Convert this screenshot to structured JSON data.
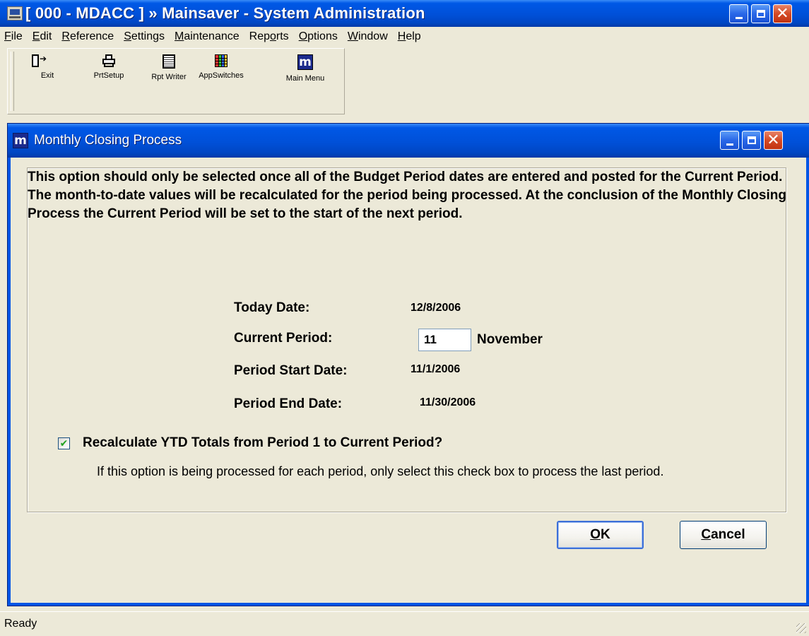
{
  "window": {
    "title": "[ 000 - MDACC ] » Mainsaver - System Administration"
  },
  "menu": {
    "items": [
      {
        "accel": "F",
        "rest": "ile"
      },
      {
        "accel": "E",
        "rest": "dit"
      },
      {
        "accel": "R",
        "rest": "eference"
      },
      {
        "accel": "S",
        "rest": "ettings"
      },
      {
        "accel": "M",
        "rest": "aintenance"
      },
      {
        "pre": "Rep",
        "accel": "o",
        "rest": "rts"
      },
      {
        "accel": "O",
        "rest": "ptions"
      },
      {
        "accel": "W",
        "rest": "indow"
      },
      {
        "accel": "H",
        "rest": "elp"
      }
    ]
  },
  "toolbar": {
    "exit": "Exit",
    "prtsetup": "PrtSetup",
    "rptwriter": "Rpt Writer",
    "appswitches": "AppSwitches",
    "mainmenu": "Main Menu",
    "mainmenu_icon_letter": "m"
  },
  "dialog": {
    "icon_letter": "m",
    "title": "Monthly Closing Process",
    "intro": "This option should only be selected once all of the Budget Period dates are entered and posted for the Current Period.  The month-to-date values will be recalculated for the period being processed.  At the conclusion of the Monthly Closing Process the Current Period will be set to the start of the next period.",
    "today_label": "Today Date:",
    "today_value": "12/8/2006",
    "current_period_label": "Current Period:",
    "current_period_value": "11",
    "current_period_name": "November",
    "start_label": "Period Start Date:",
    "start_value": "11/1/2006",
    "end_label": "Period End Date:",
    "end_value": "11/30/2006",
    "recalc_label": "Recalculate YTD Totals from Period 1 to Current Period?",
    "recalc_checked": true,
    "recalc_note": "If this option is being processed for each period, only select this check box to process the last period.",
    "ok_accel": "O",
    "ok_rest": "K",
    "cancel_accel": "C",
    "cancel_rest": "ancel"
  },
  "status": {
    "text": "Ready"
  },
  "colors": {
    "titlebar": "#0054e3",
    "dialog_bg": "#ece9d8",
    "check": "#21a121"
  }
}
